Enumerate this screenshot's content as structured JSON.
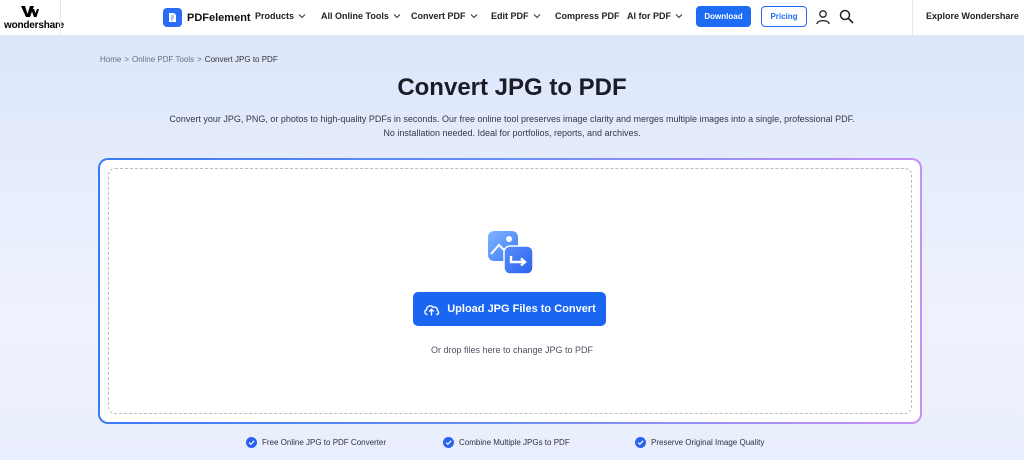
{
  "header": {
    "brand": "wondershare",
    "product": "PDFelement",
    "menu": [
      {
        "label": "Products",
        "has_dropdown": true
      },
      {
        "label": "All Online Tools",
        "has_dropdown": true
      },
      {
        "label": "Convert PDF",
        "has_dropdown": true
      },
      {
        "label": "Edit PDF",
        "has_dropdown": true
      },
      {
        "label": "Compress PDF",
        "has_dropdown": false
      },
      {
        "label": "AI for PDF",
        "has_dropdown": true
      }
    ],
    "download_label": "Download",
    "pricing_label": "Pricing",
    "explore_label": "Explore Wondershare",
    "accent_color": "#1f6cf4"
  },
  "breadcrumb": {
    "items": [
      "Home",
      "Online PDF Tools",
      "Convert JPG to PDF"
    ],
    "separator": ">"
  },
  "hero": {
    "title": "Convert JPG to PDF",
    "description_line1": "Convert your JPG, PNG, or photos to high-quality PDFs in seconds. Our free online tool preserves image clarity and merges multiple images into a single, professional PDF.",
    "description_line2": "No installation needed. Ideal for portfolios, reports, and archives."
  },
  "upload": {
    "icon": "image-convert-icon",
    "button_label": "Upload JPG Files to Convert",
    "button_icon": "cloud-upload-icon",
    "hint": "Or drop files here to change JPG to PDF"
  },
  "features": [
    "Free Online JPG to PDF Converter",
    "Combine Multiple JPGs to PDF",
    "Preserve Original Image Quality"
  ]
}
